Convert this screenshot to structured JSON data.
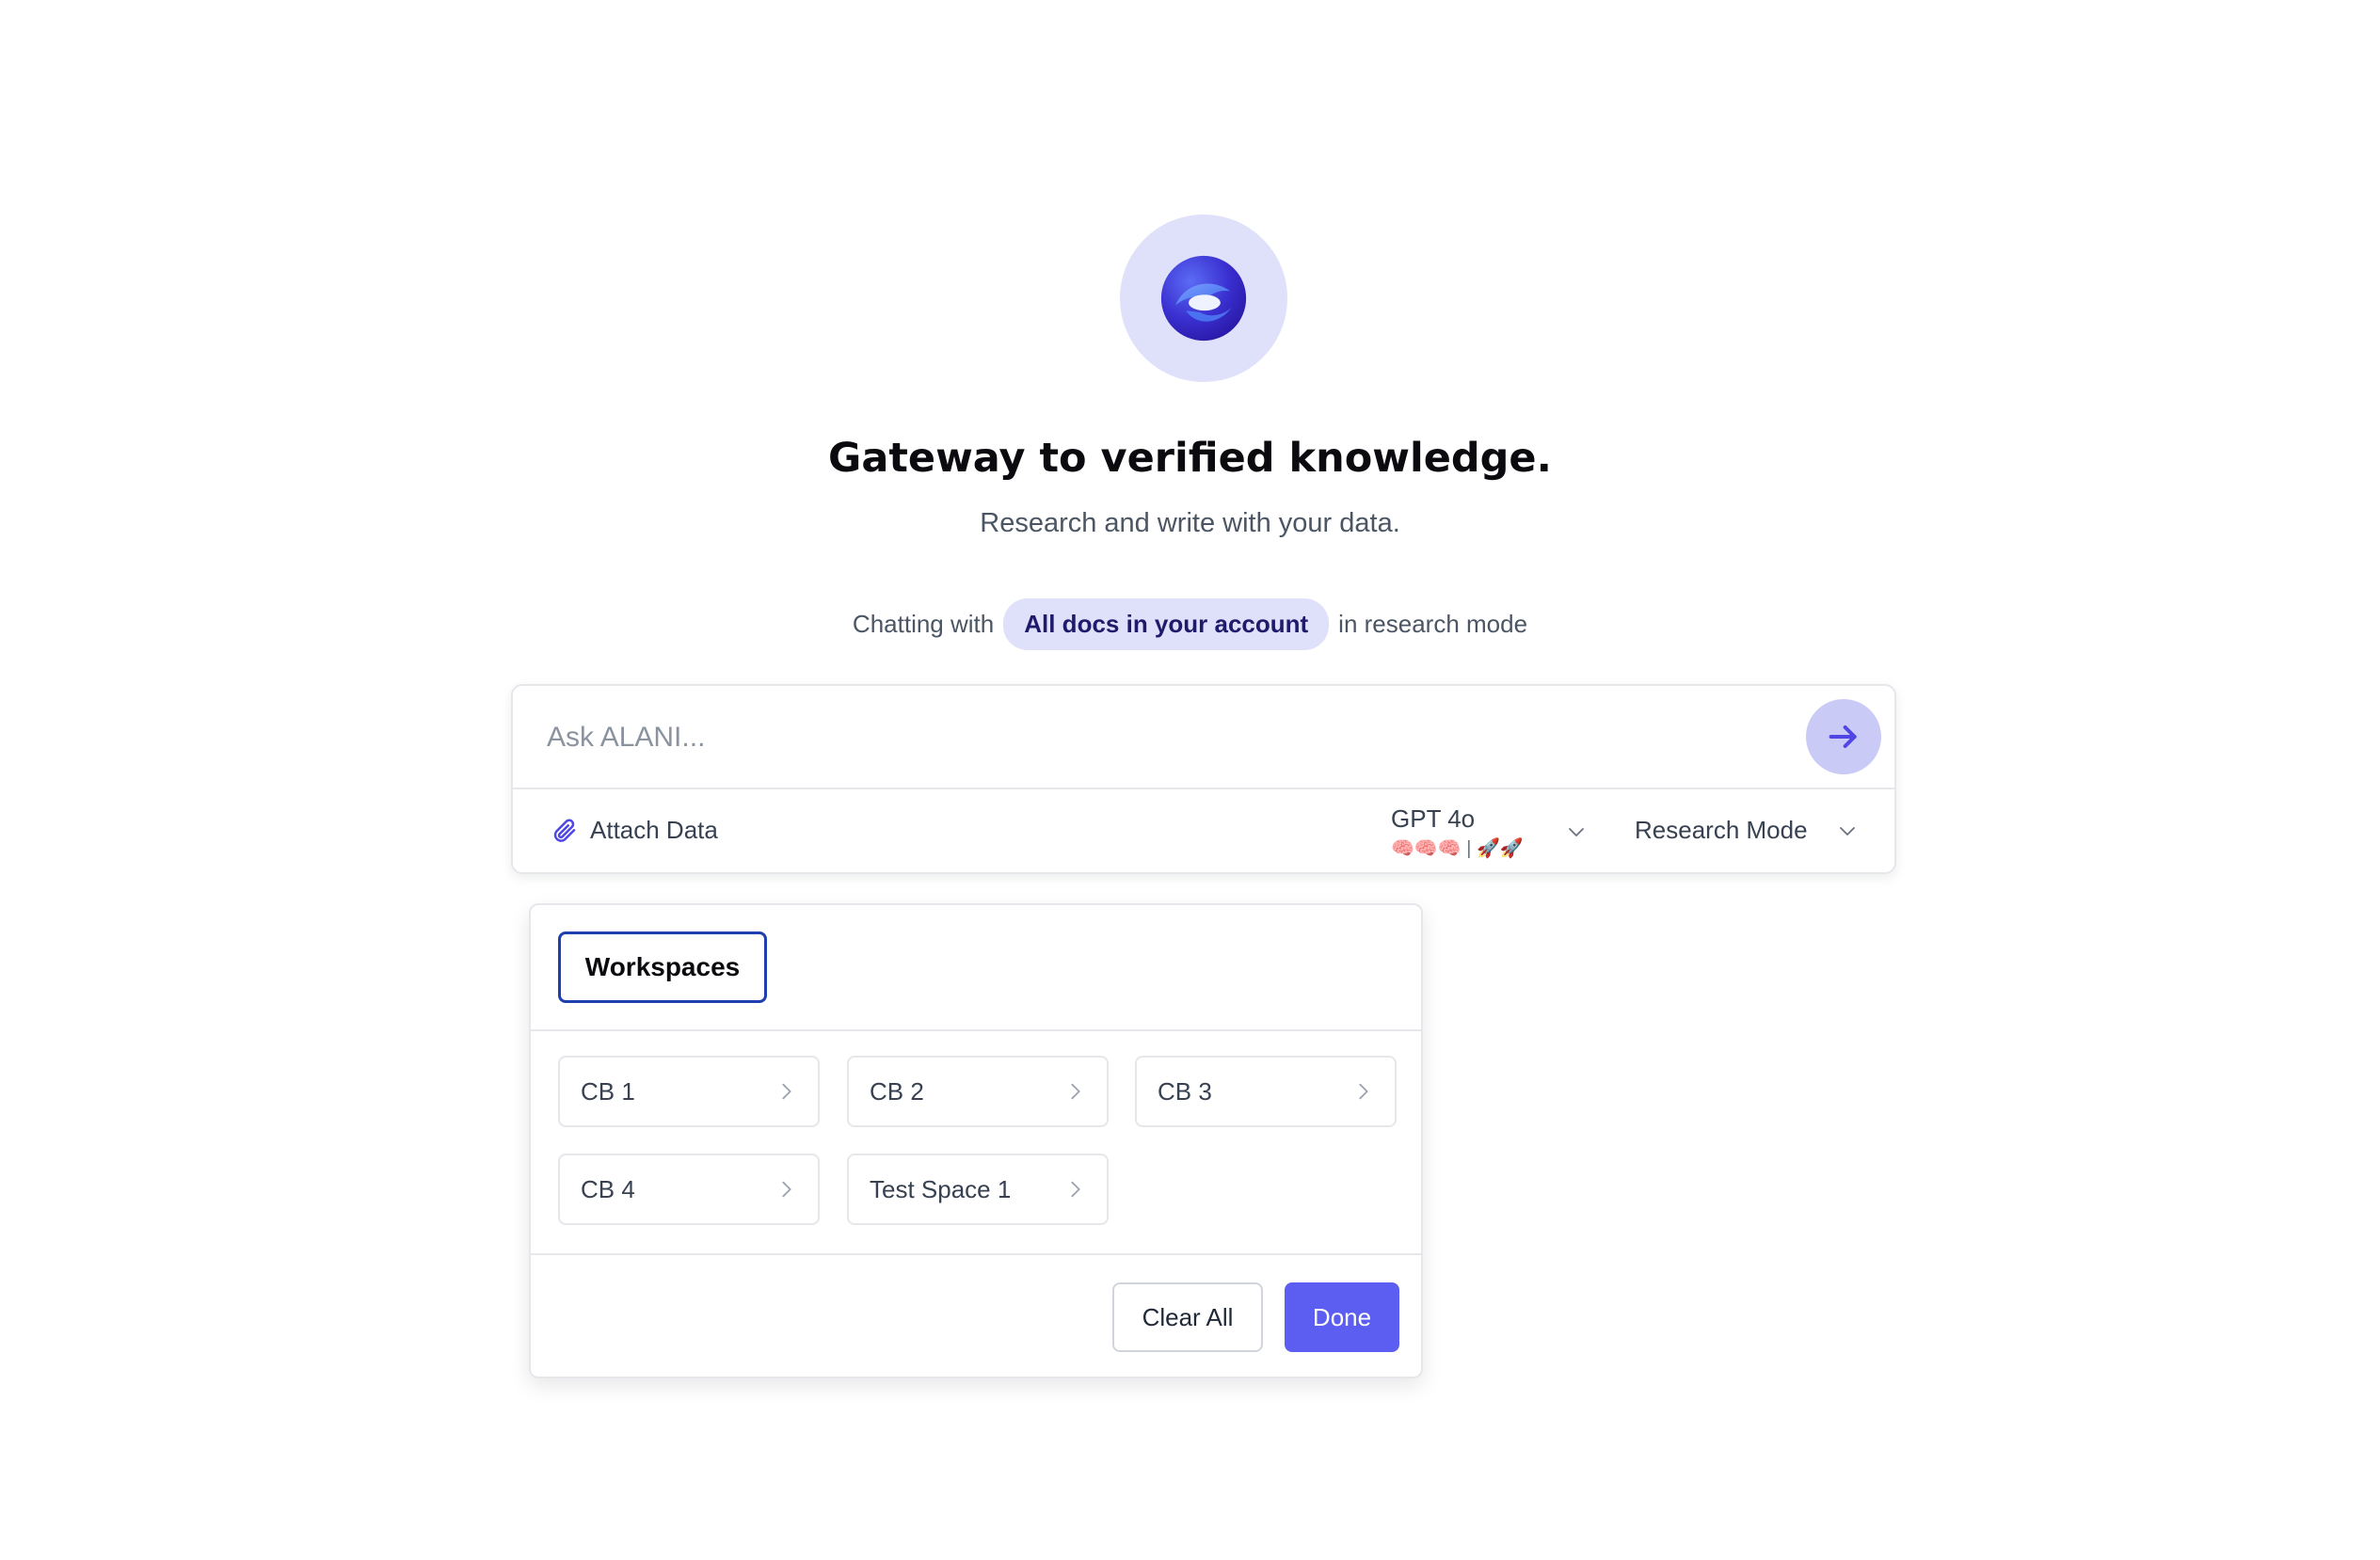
{
  "hero": {
    "title": "Gateway to verified knowledge.",
    "subtitle": "Research and write with your data."
  },
  "context": {
    "prefix": "Chatting with",
    "source_chip": "All docs in your account",
    "suffix": "in research mode"
  },
  "composer": {
    "placeholder": "Ask ALANI...",
    "attach_label": "Attach Data",
    "model_name": "GPT 4o",
    "model_rating": "🧠🧠🧠 | 🚀🚀",
    "mode_label": "Research Mode"
  },
  "panel": {
    "tab_label": "Workspaces",
    "workspaces": [
      "CB 1",
      "CB 2",
      "CB 3",
      "CB 4",
      "Test Space 1"
    ],
    "clear_label": "Clear All",
    "done_label": "Done"
  },
  "colors": {
    "accent": "#5b5ef0",
    "accent_soft": "#dfe0fa",
    "tab_border": "#1e40af"
  },
  "icons": {
    "logo": "alani-logo-icon",
    "send": "arrow-right-icon",
    "attach": "paperclip-icon",
    "chevron": "chevron-down-icon",
    "item": "chevron-right-icon"
  }
}
